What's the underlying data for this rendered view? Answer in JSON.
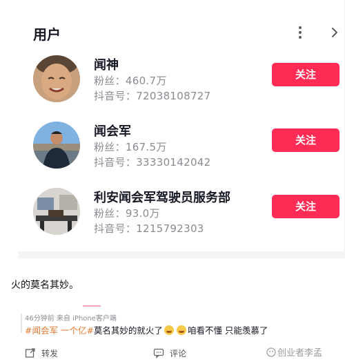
{
  "section": {
    "title": "用户",
    "more_icon": "more-vertical-icon",
    "chevron_icon": "chevron-right-icon"
  },
  "users": [
    {
      "name": "闻神",
      "fans": "粉丝：460.7万",
      "douyin_id": "抖音号：72038108727",
      "follow_label": "关注"
    },
    {
      "name": "闻会军",
      "fans": "粉丝：167.5万",
      "douyin_id": "抖音号：33330142042",
      "follow_label": "关注"
    },
    {
      "name": "利安闻会军驾驶员服务部",
      "fans": "粉丝：93.0万",
      "douyin_id": "抖音号：1215792303",
      "follow_label": "关注"
    }
  ],
  "post": {
    "text": "火的莫名其妙。"
  },
  "comment": {
    "meta": "46分钟前  来自 iPhone客户端",
    "hashtag1": "#闻会军 一个亿#",
    "text_part1": "莫名其妙的就火了",
    "text_part2": "咱看不懂 只能羡慕了"
  },
  "actions": {
    "repost_label": "转发",
    "comment_label": "评论"
  },
  "watermark": {
    "text": "创业者李孟"
  },
  "colors": {
    "follow_button": "#fe2c55",
    "hashtag": "#e07a32",
    "meta_text": "#8a8b91"
  }
}
